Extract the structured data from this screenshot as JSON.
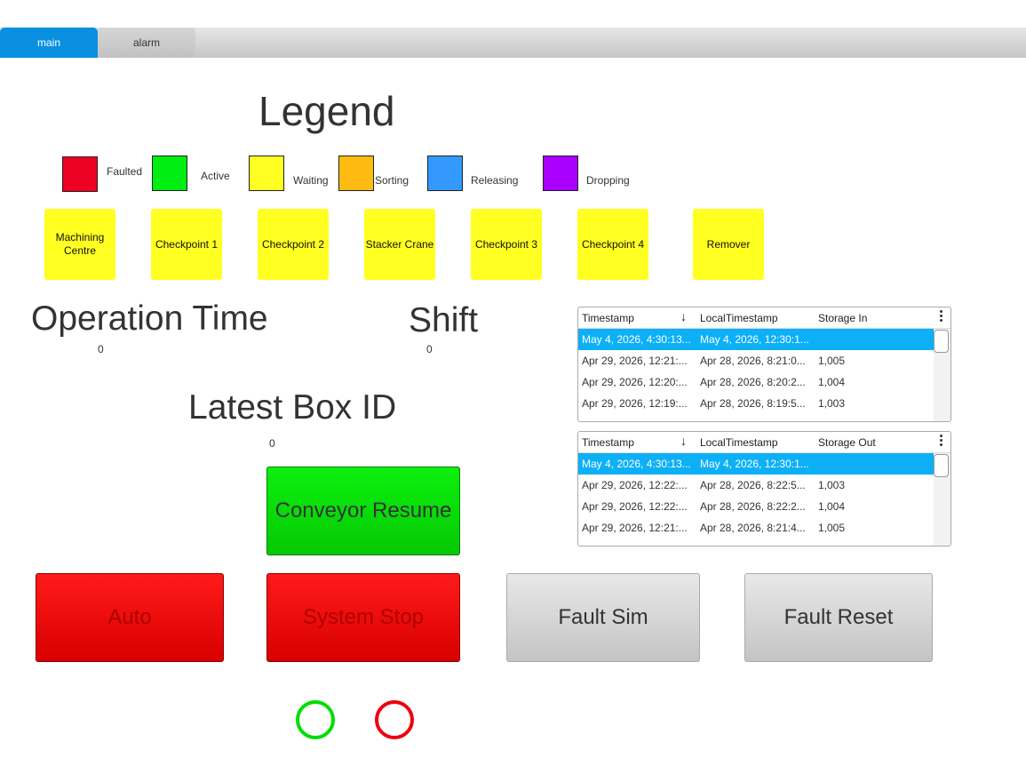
{
  "tabs": [
    {
      "label": "main",
      "active": true
    },
    {
      "label": "alarm",
      "active": false
    }
  ],
  "legend": {
    "title": "Legend",
    "items": [
      {
        "label": "Faulted",
        "color": "#ee0022"
      },
      {
        "label": "Active",
        "color": "#00ee11"
      },
      {
        "label": "Waiting",
        "color": "#ffff22"
      },
      {
        "label": "Sorting",
        "color": "#ffbb11"
      },
      {
        "label": "Releasing",
        "color": "#3399ff"
      },
      {
        "label": "Dropping",
        "color": "#aa00ff"
      }
    ]
  },
  "stations": [
    {
      "label": "Machining Centre"
    },
    {
      "label": "Checkpoint 1"
    },
    {
      "label": "Checkpoint 2"
    },
    {
      "label": "Stacker Crane"
    },
    {
      "label": "Checkpoint 3"
    },
    {
      "label": "Checkpoint 4"
    },
    {
      "label": "Remover"
    }
  ],
  "operation_time": {
    "title": "Operation Time",
    "value": "0"
  },
  "shift": {
    "title": "Shift",
    "value": "0"
  },
  "latest_box": {
    "title": "Latest Box ID",
    "value": "0"
  },
  "table_in": {
    "headers": [
      "Timestamp",
      "LocalTimestamp",
      "Storage In"
    ],
    "rows": [
      [
        "May 4, 2026, 4:30:13...",
        "May 4, 2026, 12:30:1...",
        ""
      ],
      [
        "Apr 29, 2026, 12:21:...",
        "Apr 28, 2026, 8:21:0...",
        "1,005"
      ],
      [
        "Apr 29, 2026, 12:20:...",
        "Apr 28, 2026, 8:20:2...",
        "1,004"
      ],
      [
        "Apr 29, 2026, 12:19:...",
        "Apr 28, 2026, 8:19:5...",
        "1,003"
      ]
    ]
  },
  "table_out": {
    "headers": [
      "Timestamp",
      "LocalTimestamp",
      "Storage Out"
    ],
    "rows": [
      [
        "May 4, 2026, 4:30:13...",
        "May 4, 2026, 12:30:1...",
        ""
      ],
      [
        "Apr 29, 2026, 12:22:...",
        "Apr 28, 2026, 8:22:5...",
        "1,003"
      ],
      [
        "Apr 29, 2026, 12:22:...",
        "Apr 28, 2026, 8:22:2...",
        "1,004"
      ],
      [
        "Apr 29, 2026, 12:21:...",
        "Apr 28, 2026, 8:21:4...",
        "1,005"
      ]
    ]
  },
  "buttons": {
    "conveyor_resume": "Conveyor Resume",
    "auto": "Auto",
    "system_stop": "System Stop",
    "fault_sim": "Fault Sim",
    "fault_reset": "Fault Reset"
  },
  "indicators": [
    {
      "name": "green",
      "color": "#00dd00"
    },
    {
      "name": "red",
      "color": "#ee0011"
    }
  ]
}
